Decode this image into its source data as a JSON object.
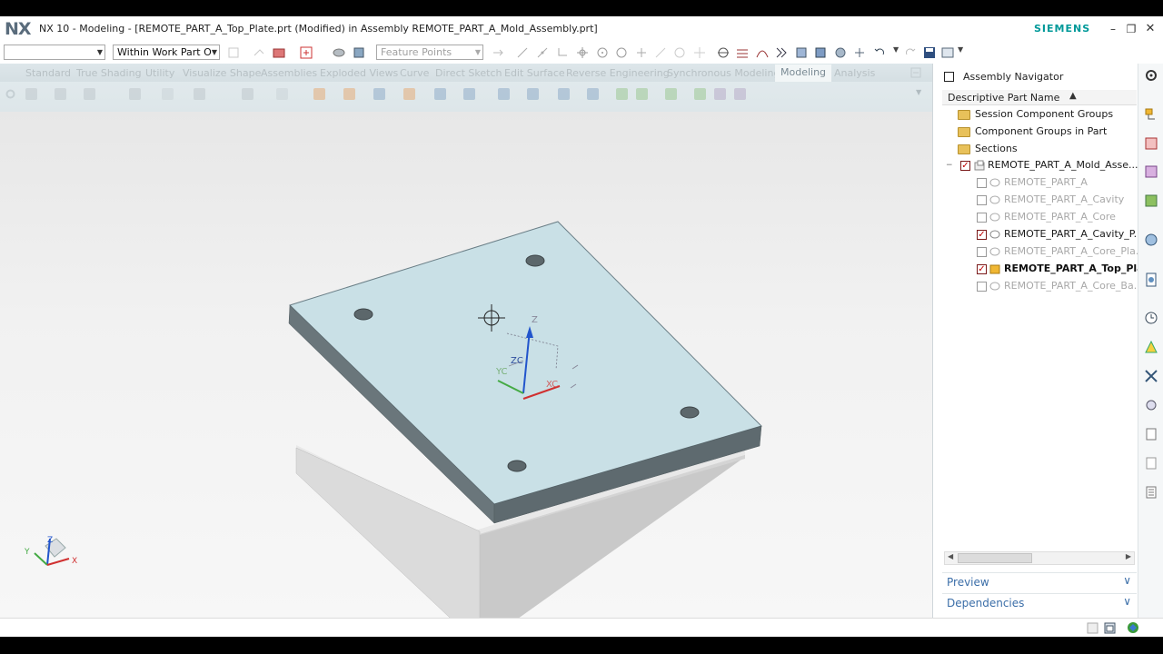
{
  "app": {
    "logo": "NX",
    "title": "NX 10 - Modeling - [REMOTE_PART_A_Top_Plate.prt (Modified)  in Assembly REMOTE_PART_A_Mold_Assembly.prt]",
    "brand": "SIEMENS",
    "window_controls": [
      "minimize",
      "restore",
      "close"
    ]
  },
  "toolbar": {
    "filter_dropdown": "",
    "scope_dropdown": "Within Work Part O",
    "snap_dropdown": "Feature Points"
  },
  "ribbon": {
    "tabs": [
      "Standard",
      "True Shading",
      "Utility",
      "Visualize Shape",
      "Assemblies",
      "Exploded Views",
      "Curve",
      "Direct Sketch",
      "Edit Surface",
      "Reverse Engineering",
      "Synchronous Modeling",
      "Modeling",
      "Analysis"
    ],
    "active_tab": "Modeling"
  },
  "viewport": {
    "csys_labels": {
      "z": "Z",
      "zc": "ZC",
      "yc": "YC",
      "xc": "XC"
    },
    "triad_labels": {
      "z": "Z",
      "y": "Y",
      "x": "X"
    }
  },
  "navigator": {
    "title": "Assembly Navigator",
    "column_header": "Descriptive Part Name",
    "groups": [
      "Session Component Groups",
      "Component Groups in Part",
      "Sections"
    ],
    "root": "REMOTE_PART_A_Mold_Asse...",
    "components": [
      {
        "name": "REMOTE_PART_A",
        "state": "unchecked",
        "style": "dim"
      },
      {
        "name": "REMOTE_PART_A_Cavity",
        "state": "unchecked",
        "style": "dim"
      },
      {
        "name": "REMOTE_PART_A_Core",
        "state": "unchecked",
        "style": "dim"
      },
      {
        "name": "REMOTE_PART_A_Cavity_P...",
        "state": "checked",
        "style": "normal"
      },
      {
        "name": "REMOTE_PART_A_Core_Pla...",
        "state": "unchecked",
        "style": "dim"
      },
      {
        "name": "REMOTE_PART_A_Top_Pla...",
        "state": "checked",
        "style": "bold"
      },
      {
        "name": "REMOTE_PART_A_Core_Ba...",
        "state": "unchecked",
        "style": "dim"
      }
    ],
    "sections": [
      "Preview",
      "Dependencies"
    ]
  },
  "colors": {
    "plate_top": "#c6dfe6",
    "plate_side": "#5e6a6f",
    "brand": "#009999",
    "link": "#3b6ea8"
  }
}
